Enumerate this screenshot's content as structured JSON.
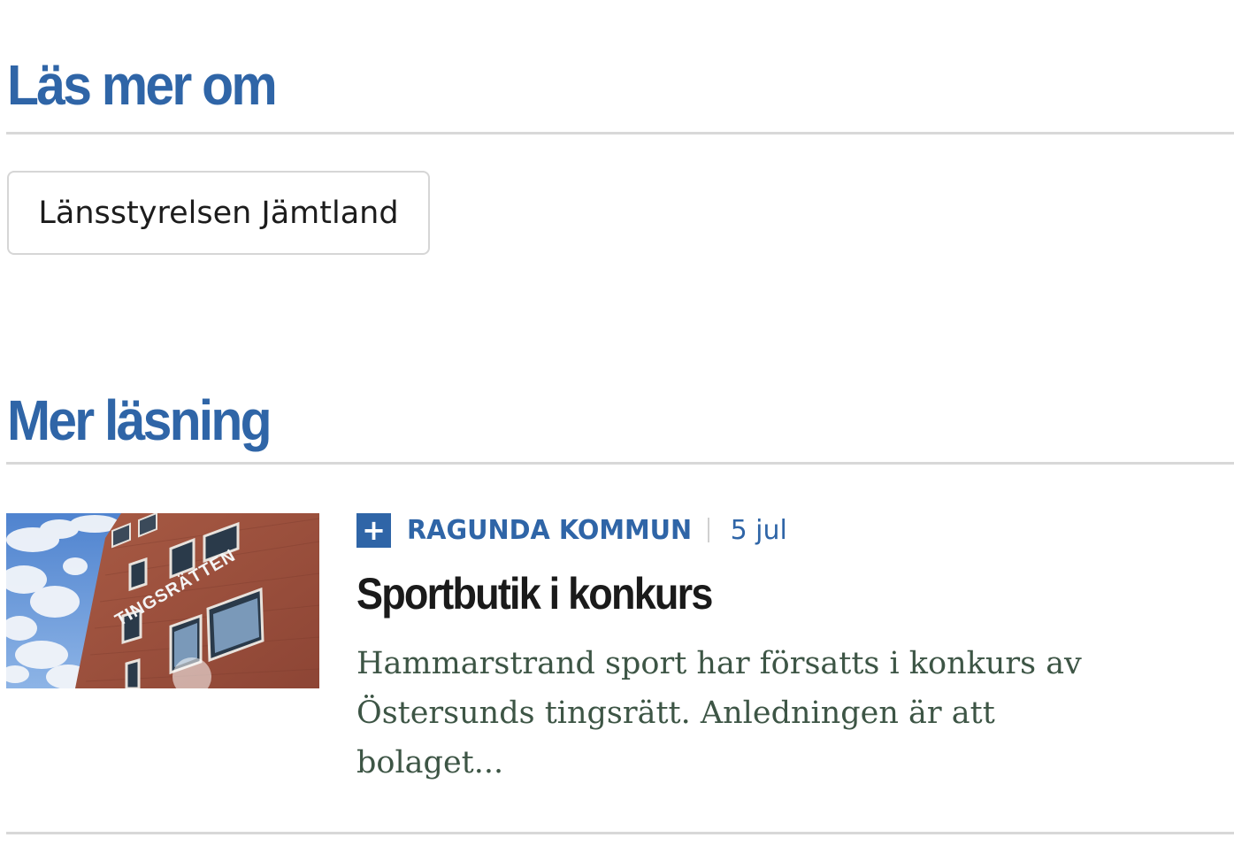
{
  "read_more": {
    "heading": "Läs mer om",
    "tags": [
      {
        "label": "Länsstyrelsen Jämtland"
      }
    ]
  },
  "more_reading": {
    "heading": "Mer läsning",
    "articles": [
      {
        "premium_icon": "plus-icon",
        "category": "RAGUNDA KOMMUN",
        "date": "5 jul",
        "title": "Sportbutik i konkurs",
        "lead": "Hammarstrand sport har försatts i konkurs av Östersunds tingsrätt. Anledningen är att bolaget...",
        "image_sign_text": "TINGSRÄTTEN"
      }
    ]
  },
  "colors": {
    "accent": "#2f65a7",
    "title": "#1a1a1a",
    "lead": "#3d5545",
    "rule": "#d8d8d8"
  }
}
